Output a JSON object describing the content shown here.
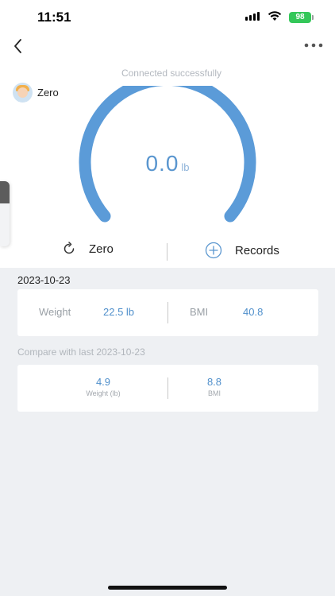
{
  "status_bar": {
    "time": "11:51",
    "battery": "98"
  },
  "header": {
    "connection_status": "Connected successfully"
  },
  "user": {
    "name": "Zero"
  },
  "scale": {
    "value": "0.0",
    "unit": "lb"
  },
  "actions": {
    "zero_label": "Zero",
    "records_label": "Records"
  },
  "measurement": {
    "date": "2023-10-23",
    "weight_label": "Weight",
    "weight_value": "22.5 lb",
    "bmi_label": "BMI",
    "bmi_value": "40.8"
  },
  "comparison": {
    "title": "Compare with last 2023-10-23",
    "weight_value": "4.9",
    "weight_label": "Weight (lb)",
    "bmi_value": "8.8",
    "bmi_label": "BMI"
  },
  "colors": {
    "accent": "#5a96cf",
    "gauge": "#5b9bd8",
    "battery": "#34c759"
  },
  "icons": {
    "back": "chevron-left-icon",
    "more": "more-horizontal-icon",
    "zero": "refresh-icon",
    "records": "plus-circle-icon"
  }
}
